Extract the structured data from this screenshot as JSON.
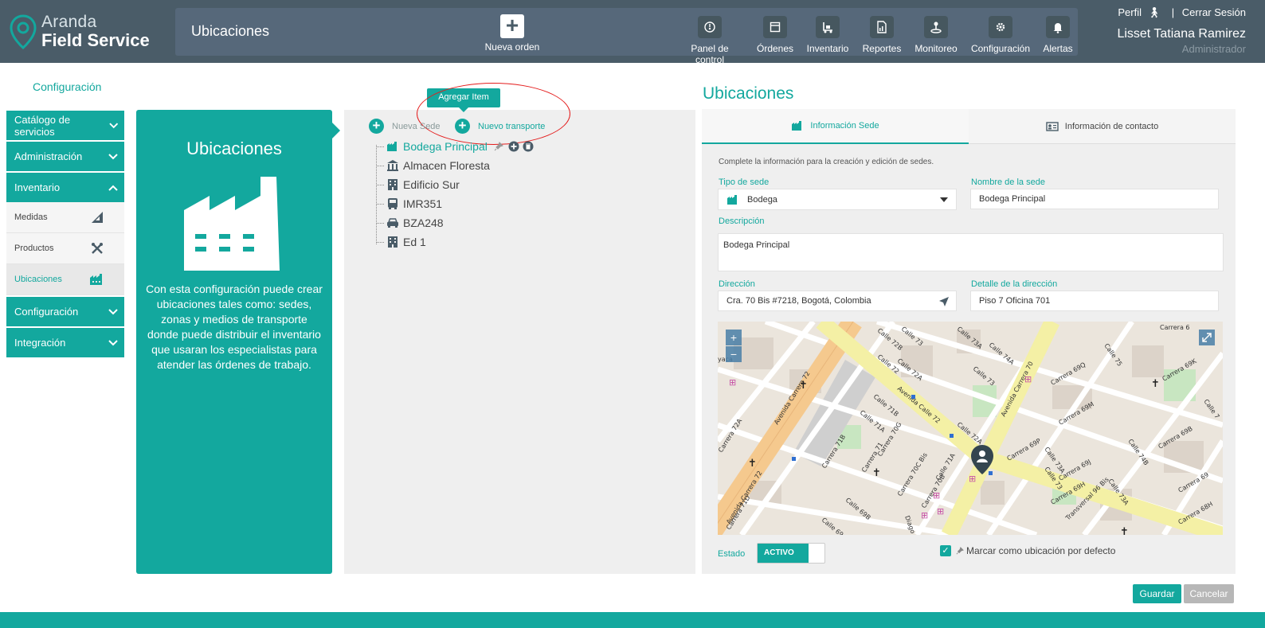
{
  "colors": {
    "header": "#4a5c68",
    "accent": "#13a89e",
    "panel": "#efefef"
  },
  "header": {
    "logo_line1": "Aranda",
    "logo_line2": "Field Service",
    "page_title": "Ubicaciones",
    "new_order_label": "Nueva orden",
    "nav": [
      {
        "label": "Panel de control",
        "icon": "dashboard-icon"
      },
      {
        "label": "Órdenes",
        "icon": "orders-icon"
      },
      {
        "label": "Inventario",
        "icon": "inventory-icon"
      },
      {
        "label": "Reportes",
        "icon": "reports-icon"
      },
      {
        "label": "Monitoreo",
        "icon": "monitoring-icon"
      },
      {
        "label": "Configuración",
        "icon": "gear-icon"
      },
      {
        "label": "Alertas",
        "icon": "bell-icon"
      }
    ],
    "profile_link": "Perfil",
    "separator": "|",
    "logout_link": "Cerrar Sesión",
    "user_name": "Lisset Tatiana Ramirez",
    "user_role": "Administrador"
  },
  "breadcrumb": "Configuración",
  "sidebar": {
    "sections": [
      {
        "label": "Catálogo de servicios",
        "expanded": false
      },
      {
        "label": "Administración",
        "expanded": false
      },
      {
        "label": "Inventario",
        "expanded": true
      }
    ],
    "subitems": [
      {
        "label": "Medidas",
        "icon": "ruler-icon"
      },
      {
        "label": "Productos",
        "icon": "tools-icon"
      },
      {
        "label": "Ubicaciones",
        "icon": "factory-icon",
        "active": true
      }
    ],
    "sections_after": [
      {
        "label": "Configuración",
        "expanded": false
      },
      {
        "label": "Integración",
        "expanded": false
      }
    ]
  },
  "info_panel": {
    "title": "Ubicaciones",
    "description": "Con esta configuración puede crear ubicaciones tales como: sedes, zonas y medios de transporte donde puede distribuir el inventario que usaran los especialistas para atender las órdenes de trabajo."
  },
  "tree_panel": {
    "tooltip": "Agregar Item",
    "add_site_label": "Nueva Sede",
    "add_transport_label": "Nuevo transporte",
    "items": [
      {
        "label": "Bodega Principal",
        "icon": "warehouse-icon",
        "selected": true
      },
      {
        "label": "Almacen Floresta",
        "icon": "bank-building-icon"
      },
      {
        "label": "Edificio Sur",
        "icon": "building-icon"
      },
      {
        "label": "IMR351",
        "icon": "bus-icon"
      },
      {
        "label": "BZA248",
        "icon": "car-icon"
      },
      {
        "label": "Ed 1",
        "icon": "building-icon"
      }
    ]
  },
  "form": {
    "title": "Ubicaciones",
    "tabs": [
      {
        "label": "Información Sede",
        "icon": "factory-icon",
        "active": true
      },
      {
        "label": "Información de contacto",
        "icon": "contact-card-icon"
      }
    ],
    "hint": "Complete la información para la creación y edición de sedes.",
    "site_type_label": "Tipo de sede",
    "site_type_value": "Bodega",
    "site_name_label": "Nombre de la sede",
    "site_name_value": "Bodega Principal",
    "description_label": "Descripción",
    "description_value": "Bodega Principal",
    "address_label": "Dirección",
    "address_value": "Cra. 70 Bis #7218, Bogotá, Colombia",
    "address_detail_label": "Detalle de la dirección",
    "address_detail_value": "Piso 7 Oficina 701",
    "status_label": "Estado",
    "status_value": "ACTIVO",
    "default_checkbox_label": "Marcar como ubicación por defecto",
    "default_checked": true,
    "save_label": "Guardar",
    "cancel_label": "Cancelar"
  },
  "map": {
    "zoom_in": "+",
    "zoom_out": "−",
    "streets": [
      "Avenida Carrera 72",
      "Avenida Carrera 72",
      "Avenida Carrera 70",
      "Calle 72",
      "Calle 72A",
      "Calle 73",
      "Calle 73A",
      "Calle 74A",
      "Calle 72B",
      "Calle 71B",
      "Calle 71A",
      "Carrera 72A",
      "Carrera 71B",
      "Carrera 71",
      "Carrera 70G",
      "Carrera 70C Bis",
      "Carrera 70B",
      "Calle 71A",
      "Calle 69B",
      "Calle 69A",
      "Carrera 69P",
      "Carrera 69Q",
      "Carrera 69M",
      "Carrera 69B",
      "Carrera 69",
      "Carrera 69H",
      "Carrera 69K",
      "Calle 75",
      "Calle 74B",
      "Calle 73A",
      "Transversal 96 Bis",
      "Calle 73",
      "Carrera 69J",
      "Carrera 68H",
      "Calle 73",
      "Avenida Calle 72",
      "Calle 72A",
      "Carrera 71D",
      "Diago"
    ]
  }
}
